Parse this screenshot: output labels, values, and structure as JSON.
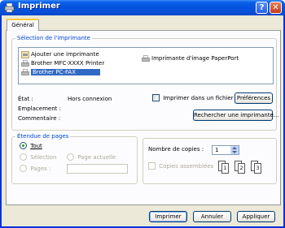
{
  "window": {
    "title": "Imprimer",
    "help_glyph": "?",
    "close_glyph": "✕"
  },
  "tabs": [
    {
      "label": "Général"
    }
  ],
  "printer_selection": {
    "legend": "Sélection de l'imprimante",
    "printers": [
      {
        "label": "Ajouter une imprimante",
        "icon": "add-printer-icon"
      },
      {
        "label": "Brother MFC-XXXX  Printer",
        "icon": "printer-icon"
      },
      {
        "label": "Brother PC-FAX",
        "icon": "fax-printer-icon",
        "selected": true
      },
      {
        "label": "Imprimante d'image PaperPort",
        "icon": "printer-icon"
      }
    ],
    "status_label": "État :",
    "status_value": "Hors connexion",
    "location_label": "Emplacement :",
    "comment_label": "Commentaire :",
    "print_to_file_label": "Imprimer dans un fichier",
    "print_to_file_checked": false,
    "preferences_button": "Préférences",
    "find_printer_button": "Rechercher une imprimante..."
  },
  "page_range": {
    "legend": "Étendue de pages",
    "all_label": "Tout",
    "selection_label": "Sélection",
    "current_page_label": "Page actuelle",
    "pages_label": "Pages :",
    "pages_value": "",
    "selected": "all"
  },
  "copies": {
    "count_label": "Nombre de copies :",
    "count_value": "1",
    "collate_label": "Copies assemblées",
    "collate_checked": false,
    "collate_icon_numbers": [
      "1",
      "1",
      "2",
      "2",
      "3",
      "3"
    ]
  },
  "footer": {
    "print_button": "Imprimer",
    "cancel_button": "Annuler",
    "apply_button": "Appliquer"
  }
}
